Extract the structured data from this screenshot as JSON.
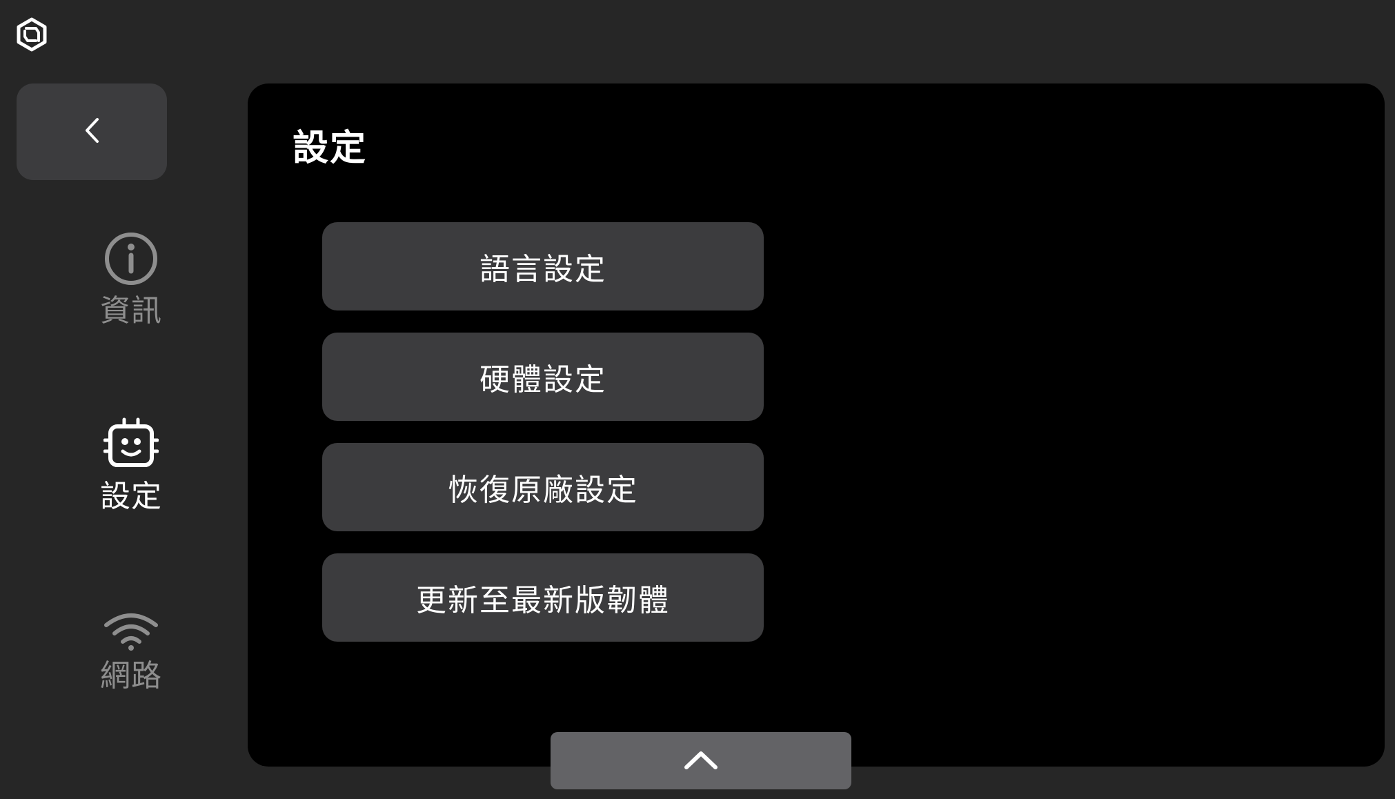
{
  "header": {
    "logo_icon": "brand-hexagon-icon"
  },
  "sidebar": {
    "back_icon": "chevron-left-icon",
    "items": [
      {
        "label": "資訊",
        "icon": "info-circle-icon",
        "active": false
      },
      {
        "label": "設定",
        "icon": "robot-face-icon",
        "active": true
      },
      {
        "label": "網路",
        "icon": "wifi-icon",
        "active": false
      }
    ]
  },
  "main": {
    "title": "設定",
    "buttons": [
      {
        "label": "語言設定"
      },
      {
        "label": "硬體設定"
      },
      {
        "label": "恢復原廠設定"
      },
      {
        "label": "更新至最新版韌體"
      }
    ],
    "scroll_up_icon": "chevron-up-icon"
  },
  "colors": {
    "background": "#262626",
    "panel": "#000000",
    "button": "#3c3c3e",
    "scroll_button": "#636366",
    "inactive_text": "#8e8e8e",
    "active_text": "#ffffff"
  }
}
